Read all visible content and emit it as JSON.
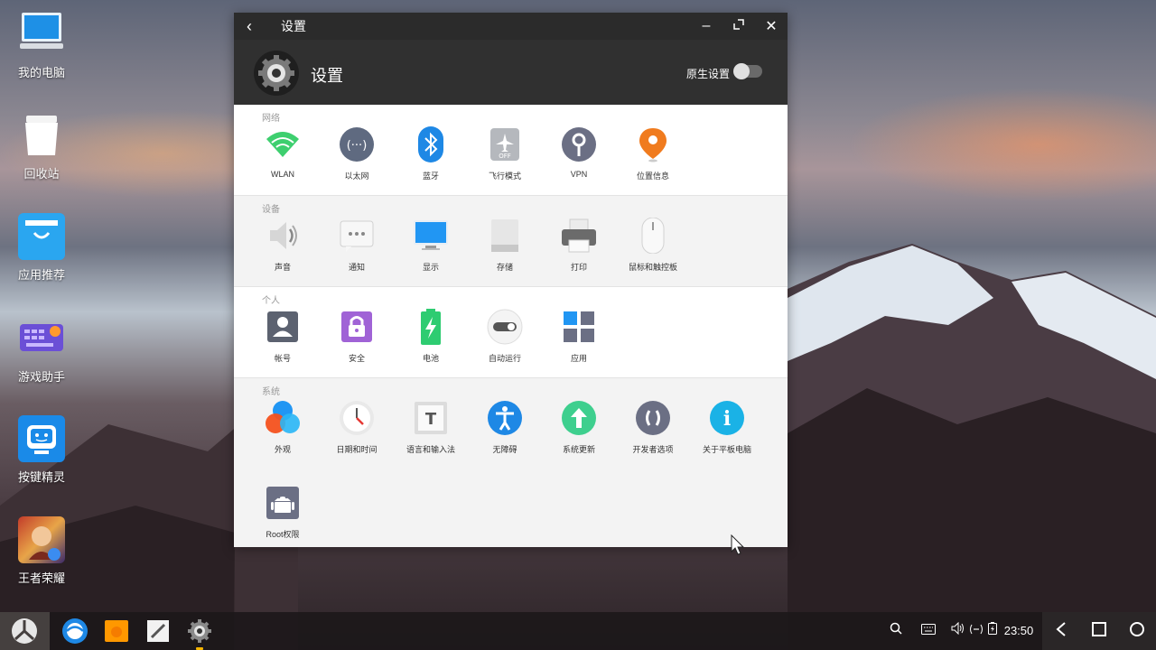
{
  "desktop": {
    "icons": [
      {
        "label": "我的电脑",
        "icon": "computer-icon"
      },
      {
        "label": "回收站",
        "icon": "recycle-bin-icon"
      },
      {
        "label": "应用推荐",
        "icon": "app-store-icon"
      },
      {
        "label": "游戏助手",
        "icon": "game-keyboard-icon"
      },
      {
        "label": "按键精灵",
        "icon": "robot-icon"
      },
      {
        "label": "王者荣耀",
        "icon": "game-hero-icon"
      }
    ]
  },
  "window": {
    "title": "设置",
    "header_title": "设置",
    "native_settings_label": "原生设置",
    "native_settings_on": false
  },
  "sections": [
    {
      "title": "网络",
      "items": [
        {
          "label": "WLAN",
          "icon": "wifi-icon"
        },
        {
          "label": "以太网",
          "icon": "ethernet-icon"
        },
        {
          "label": "蓝牙",
          "icon": "bluetooth-icon"
        },
        {
          "label": "飞行模式",
          "icon": "airplane-mode-icon",
          "badge": "OFF"
        },
        {
          "label": "VPN",
          "icon": "vpn-key-icon"
        },
        {
          "label": "位置信息",
          "icon": "location-pin-icon"
        }
      ]
    },
    {
      "title": "设备",
      "items": [
        {
          "label": "声音",
          "icon": "speaker-icon"
        },
        {
          "label": "通知",
          "icon": "notification-icon"
        },
        {
          "label": "显示",
          "icon": "monitor-icon"
        },
        {
          "label": "存储",
          "icon": "storage-icon"
        },
        {
          "label": "打印",
          "icon": "printer-icon"
        },
        {
          "label": "鼠标和触控板",
          "icon": "mouse-icon"
        }
      ]
    },
    {
      "title": "个人",
      "items": [
        {
          "label": "帐号",
          "icon": "account-icon"
        },
        {
          "label": "安全",
          "icon": "lock-icon"
        },
        {
          "label": "电池",
          "icon": "battery-icon"
        },
        {
          "label": "自动运行",
          "icon": "autostart-toggle-icon"
        },
        {
          "label": "应用",
          "icon": "apps-grid-icon"
        }
      ]
    },
    {
      "title": "系统",
      "items": [
        {
          "label": "外观",
          "icon": "appearance-icon"
        },
        {
          "label": "日期和时间",
          "icon": "clock-icon"
        },
        {
          "label": "语言和输入法",
          "icon": "language-input-icon",
          "glyph": "T"
        },
        {
          "label": "无障碍",
          "icon": "accessibility-icon"
        },
        {
          "label": "系统更新",
          "icon": "system-update-icon"
        },
        {
          "label": "开发者选项",
          "icon": "developer-options-icon"
        },
        {
          "label": "关于平板电脑",
          "icon": "about-info-icon",
          "glyph": "i"
        },
        {
          "label": "Root权限",
          "icon": "android-root-icon"
        }
      ]
    }
  ],
  "taskbar": {
    "apps": [
      "browser-icon",
      "file-manager-icon",
      "notes-icon",
      "settings-icon"
    ],
    "clock": "23:50",
    "tray_icons": [
      "search-icon",
      "keyboard-icon",
      "volume-icon",
      "network-icon",
      "battery-icon"
    ]
  },
  "colors": {
    "titlebar": "#2b2b2b",
    "header": "#303030",
    "wifi": "#3ecf6f",
    "bluetooth": "#1e88e5",
    "accent_blue": "#2196f3"
  }
}
